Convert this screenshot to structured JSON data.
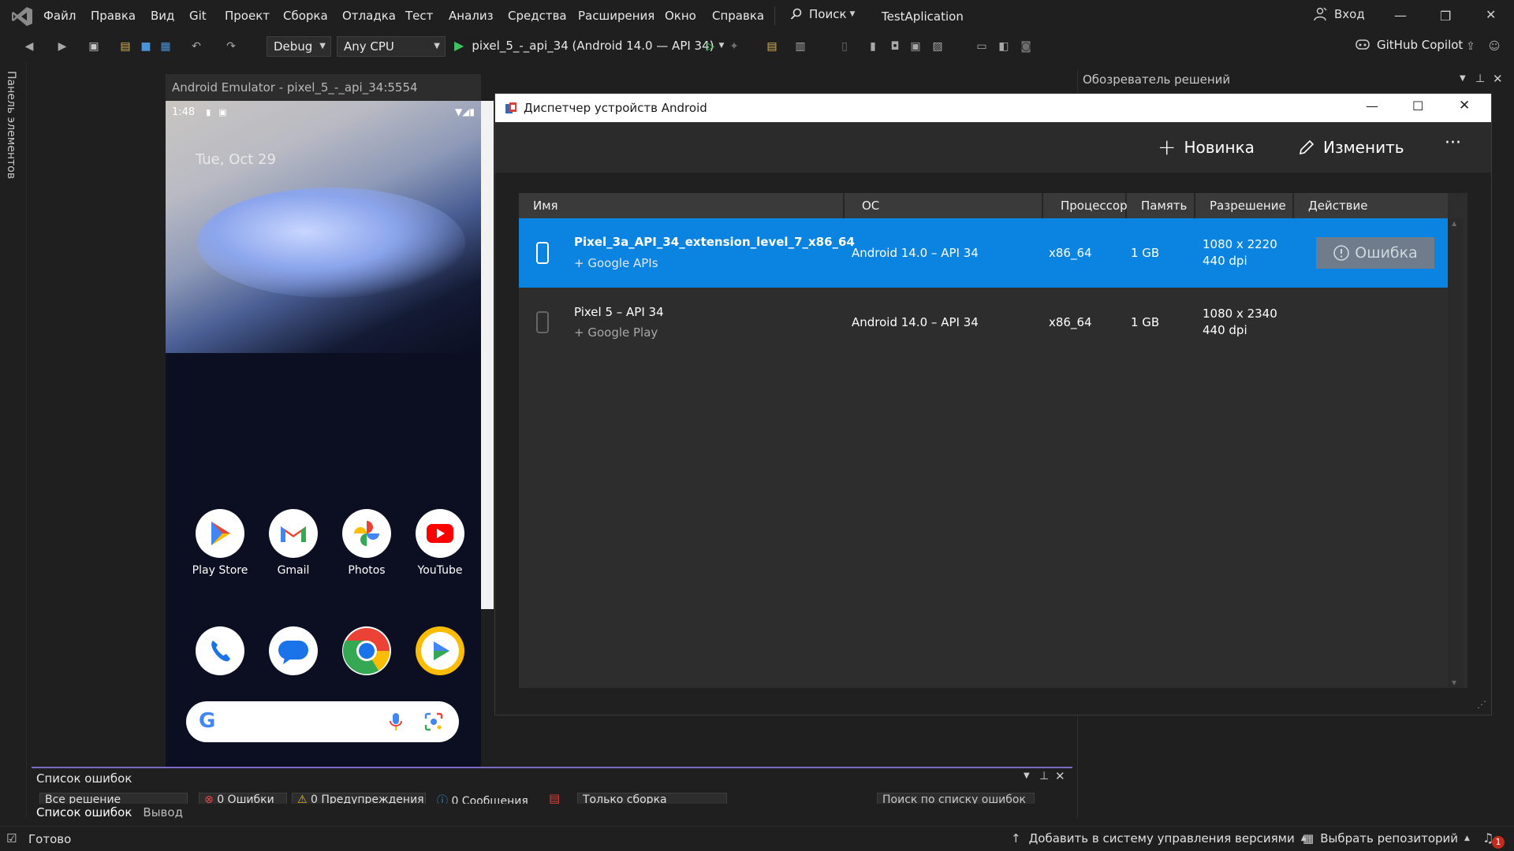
{
  "menubar": {
    "items": [
      "Файл",
      "Правка",
      "Вид",
      "Git",
      "Проект",
      "Сборка",
      "Отладка",
      "Тест",
      "Анализ",
      "Средства",
      "Расширения",
      "Окно",
      "Справка"
    ],
    "search_label": "Поиск",
    "solution_name": "TestAplication",
    "signin_label": "Вход"
  },
  "toolbar": {
    "config": "Debug",
    "platform": "Any CPU",
    "run_target": "pixel_5_-_api_34 (Android 14.0 — API 34)",
    "copilot_label": "GitHub Copilot"
  },
  "leftbar": {
    "toolbox_label": "Панель элементов"
  },
  "emulator": {
    "title": "Android Emulator - pixel_5_-_api_34:5554",
    "time": "1:48",
    "date": "Tue, Oct 29",
    "apps_row1": [
      "Play Store",
      "Gmail",
      "Photos",
      "YouTube"
    ],
    "dock_icons": [
      "phone-icon",
      "messages-icon",
      "chrome-icon",
      "play-games-icon"
    ]
  },
  "device_manager": {
    "title": "Диспетчер устройств Android",
    "new_label": "Новинка",
    "edit_label": "Изменить",
    "more_label": "···",
    "columns": [
      "Имя",
      "ОС",
      "Процессор",
      "Память",
      "Разрешение",
      "Действие"
    ],
    "rows": [
      {
        "name": "Pixel_3a_API_34_extension_level_7_x86_64",
        "subtitle": "+ Google APIs",
        "os": "Android 14.0 – API 34",
        "cpu": "x86_64",
        "memory": "1 GB",
        "resolution": "1080 x 2220",
        "dpi": "440 dpi",
        "action": "Ошибка",
        "selected": true
      },
      {
        "name": "Pixel 5 – API 34",
        "subtitle": "+ Google Play",
        "os": "Android 14.0 – API 34",
        "cpu": "x86_64",
        "memory": "1 GB",
        "resolution": "1080 x 2340",
        "dpi": "440 dpi",
        "action": "",
        "selected": false
      }
    ],
    "accent_color": "#0a84e0"
  },
  "solution_explorer": {
    "title": "Обозреватель решений"
  },
  "error_list": {
    "title": "Список ошибок",
    "scope": "Все решение",
    "errors": "0 Ошибки",
    "warnings": "0 Предупреждения",
    "messages": "0 Сообщения",
    "build_filter": "Только сборка",
    "search_placeholder": "Поиск по списку ошибок",
    "tabs": [
      "Список ошибок",
      "Вывод"
    ]
  },
  "status": {
    "ready": "Готово",
    "add_to_vcs": "Добавить в систему управления версиями",
    "select_repo": "Выбрать репозиторий",
    "notifications_count": "1"
  }
}
